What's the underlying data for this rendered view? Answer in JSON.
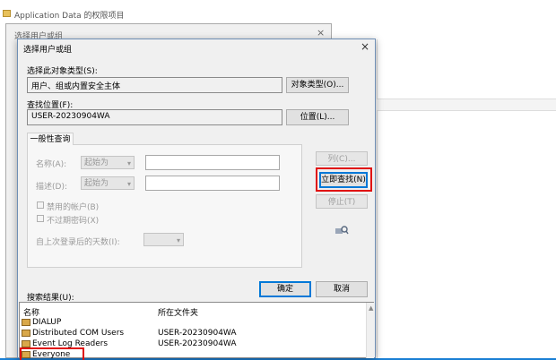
{
  "background_window": {
    "title": "Application Data 的权限项目"
  },
  "middle_window": {
    "title": "选择用户或组",
    "close": "×"
  },
  "dialog": {
    "title": "选择用户或组",
    "close": "×",
    "object_type_label": "选择此对象类型(S):",
    "object_type_value": "用户、组或内置安全主体",
    "object_type_button": "对象类型(O)...",
    "location_label": "查找位置(F):",
    "location_value": "USER-20230904WA",
    "location_button": "位置(L)...",
    "tab_general": "一般性查询",
    "name_label": "名称(A):",
    "name_combo": "起始为",
    "desc_label": "描述(D):",
    "desc_combo": "起始为",
    "disabled_accounts": "禁用的帐户(B)",
    "no_expire_password": "不过期密码(X)",
    "days_since_logon": "自上次登录后的天数(I):",
    "columns_button": "列(C)...",
    "find_now_button": "立即查找(N)",
    "stop_button": "停止(T)",
    "ok_button": "确定",
    "cancel_button": "取消",
    "results_label": "搜索结果(U):",
    "results_headers": [
      "名称",
      "所在文件夹"
    ],
    "results_rows": [
      {
        "name": "DIALUP",
        "folder": ""
      },
      {
        "name": "Distributed COM Users",
        "folder": "USER-20230904WA"
      },
      {
        "name": "Event Log Readers",
        "folder": "USER-20230904WA"
      },
      {
        "name": "Everyone",
        "folder": ""
      }
    ]
  },
  "colors": {
    "highlight_red": "#e01010",
    "accent": "#0078d7"
  }
}
